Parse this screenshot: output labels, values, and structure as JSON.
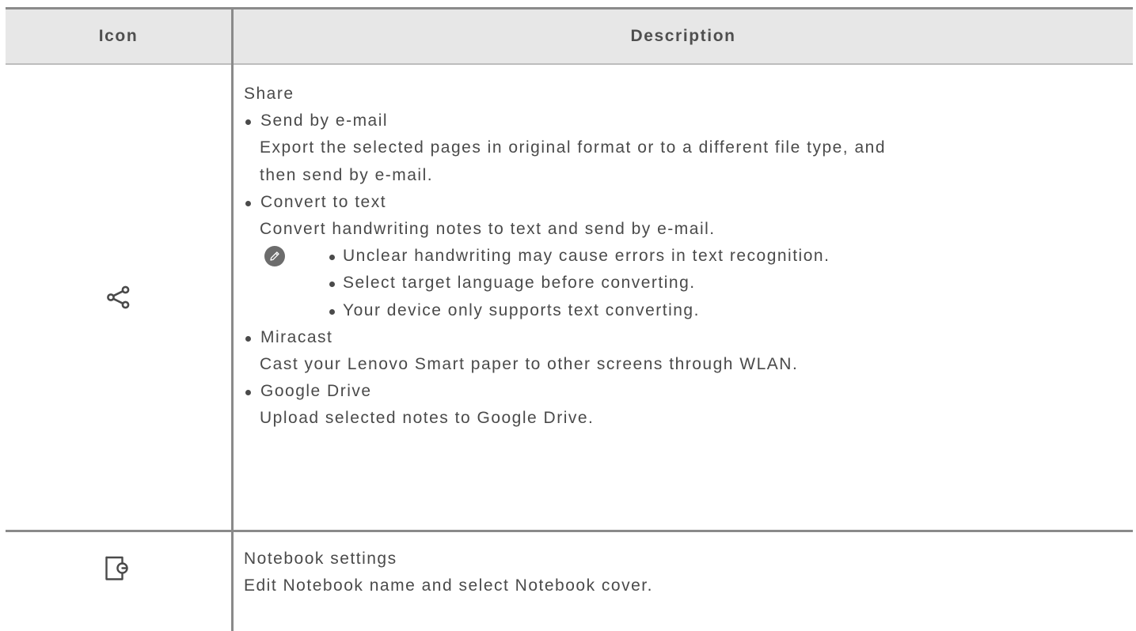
{
  "table": {
    "headers": {
      "icon": "Icon",
      "description": "Description"
    },
    "rows": [
      {
        "icon": "share-icon",
        "title": "Share",
        "items": [
          {
            "label": "Send by e-mail",
            "text_lines": [
              "Export the selected pages in original format or to a different file type, and",
              "then send by e-mail."
            ]
          },
          {
            "label": "Convert to text",
            "text_lines": [
              "Convert handwriting notes to text and send by e-mail."
            ],
            "note_icon": "pencil-note-icon",
            "notes": [
              "Unclear handwriting may cause errors in text recognition.",
              "Select target language before converting.",
              "Your device only supports text converting."
            ]
          },
          {
            "label": "Miracast",
            "text_lines": [
              "Cast your Lenovo Smart paper to other screens through WLAN."
            ]
          },
          {
            "label": "Google Drive",
            "text_lines": [
              "Upload selected notes to Google Drive."
            ]
          }
        ]
      },
      {
        "icon": "notebook-settings-icon",
        "title": "Notebook settings",
        "text_lines": [
          "Edit Notebook name and select Notebook cover."
        ]
      }
    ]
  },
  "colors": {
    "header_bg": "#e7e7e7",
    "rule": "#8a8a8a",
    "text": "#4a4a4a",
    "note_icon_bg": "#6c6c6c"
  }
}
